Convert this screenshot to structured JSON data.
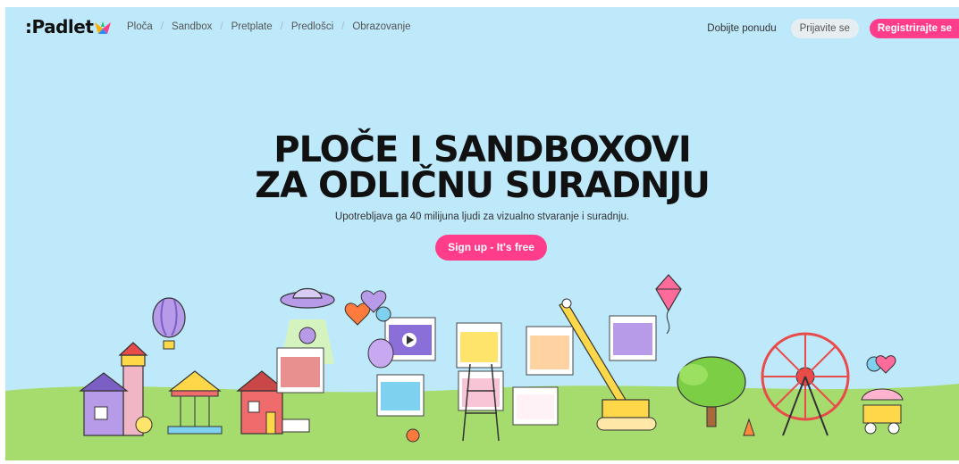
{
  "nav": {
    "logo": ":Padlet",
    "links": [
      "Ploča",
      "Sandbox",
      "Pretplate",
      "Predlošci",
      "Obrazovanje"
    ],
    "separator": "/",
    "get_quote": "Dobijte ponudu",
    "login": "Prijavite se",
    "register": "Registrirajte se"
  },
  "hero": {
    "headline_line1": "PLOČE I SANDBOXOVI",
    "headline_line2": "ZA ODLIČNU SURADNJU",
    "subtitle": "Upotrebljava ga 40 milijuna ljudi za vizualno stvaranje i suradnju.",
    "cta": "Sign up - It's free"
  },
  "colors": {
    "sky": "#bde9fb",
    "grass": "#a6dc6e",
    "accent": "#ff3d8a",
    "headline": "#111111"
  },
  "icons": [
    "padlet-logo-icon",
    "hot-air-balloon-icon",
    "ufo-icon",
    "ferris-wheel-icon",
    "carousel-icon",
    "lighthouse-icon",
    "tree-icon",
    "crane-icon",
    "kite-icon",
    "balloons-icon"
  ]
}
